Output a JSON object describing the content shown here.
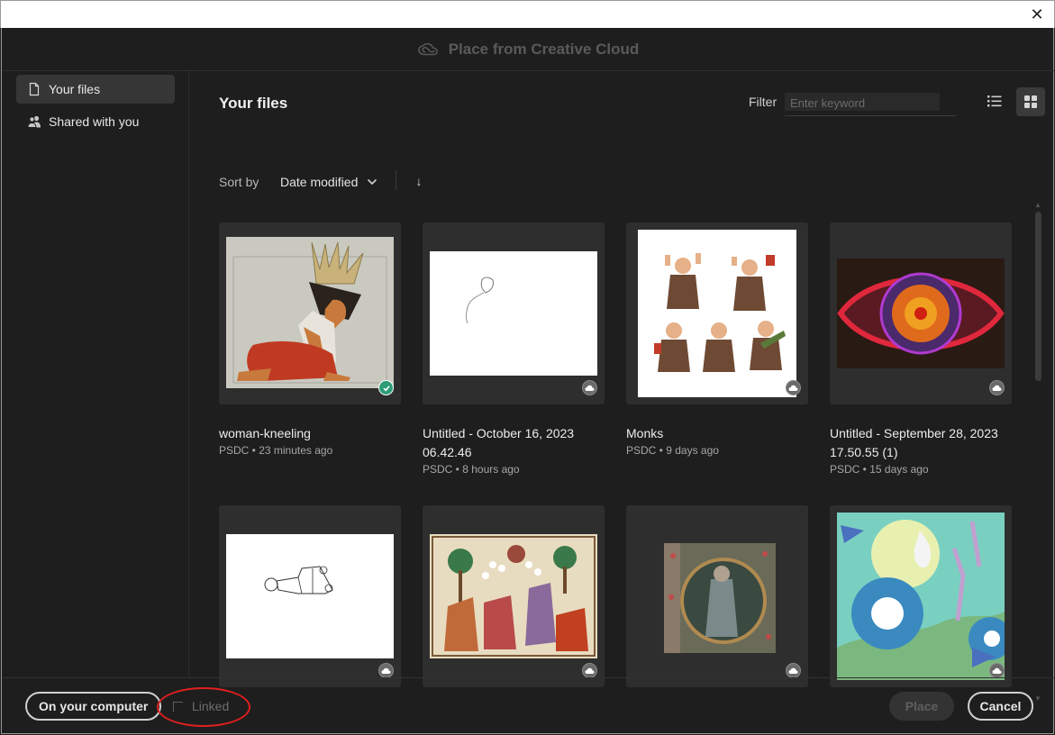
{
  "window": {
    "close_glyph": "✕"
  },
  "dialog": {
    "title": "Place from Creative Cloud",
    "title_icon": "creative-cloud-icon"
  },
  "sidebar": {
    "items": [
      {
        "label": "Your files",
        "icon": "file-icon",
        "active": true
      },
      {
        "label": "Shared with you",
        "icon": "people-icon",
        "active": false
      }
    ]
  },
  "main": {
    "title": "Your files",
    "filter": {
      "label": "Filter",
      "placeholder": "Enter keyword",
      "value": ""
    },
    "view": {
      "list_icon": "list-view-icon",
      "grid_icon": "grid-view-icon",
      "selected": "grid"
    },
    "sort": {
      "label": "Sort by",
      "value": "Date modified",
      "direction_glyph": "↓"
    }
  },
  "files": [
    {
      "name": "woman-kneeling",
      "meta": "PSDC • 23 minutes ago",
      "status": "synced"
    },
    {
      "name": "Untitled - October 16, 2023 06.42.46",
      "meta": "PSDC • 8 hours ago",
      "status": "cloud"
    },
    {
      "name": "Monks",
      "meta": "PSDC • 9 days ago",
      "status": "cloud"
    },
    {
      "name": "Untitled - September 28, 2023 17.50.55 (1)",
      "meta": "PSDC • 15 days ago",
      "status": "cloud"
    },
    {
      "name": "",
      "meta": "",
      "status": "cloud"
    },
    {
      "name": "",
      "meta": "",
      "status": "cloud"
    },
    {
      "name": "",
      "meta": "",
      "status": "cloud"
    },
    {
      "name": "",
      "meta": "",
      "status": "cloud"
    }
  ],
  "footer": {
    "computer_button": "On your computer",
    "linked_label": "Linked",
    "linked_checked": false,
    "place_button": "Place",
    "cancel_button": "Cancel"
  },
  "colors": {
    "accent_synced": "#2d9d78",
    "annotation_ring": "#e01f1f",
    "background": "#1e1e1e"
  }
}
